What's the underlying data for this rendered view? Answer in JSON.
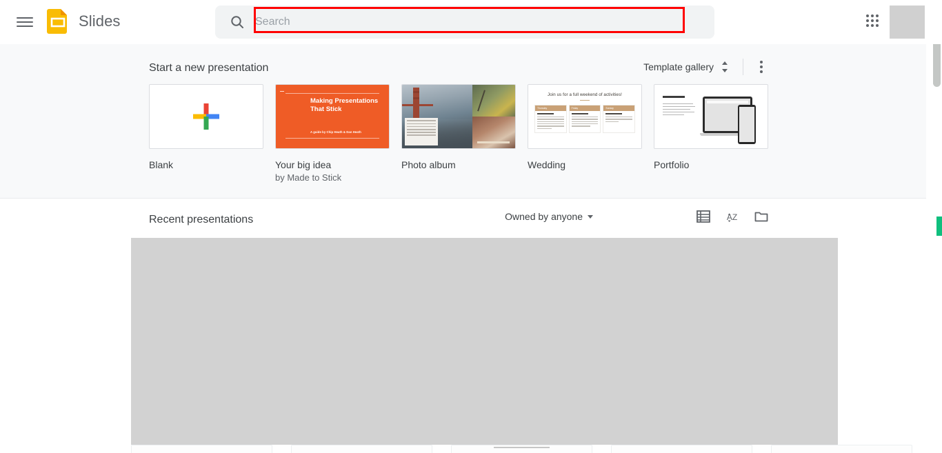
{
  "header": {
    "menu_icon": "hamburger-menu-icon",
    "logo_icon": "google-slides-logo",
    "app_title": "Slides",
    "search": {
      "icon": "search-icon",
      "placeholder": "Search",
      "value": ""
    },
    "apps_icon": "apps-grid-icon",
    "avatar": "account-avatar"
  },
  "annotation": {
    "color": "#ff0000",
    "target": "search-input"
  },
  "template_section": {
    "title": "Start a new presentation",
    "gallery_label": "Template gallery",
    "sorter_icon": "expand-collapse-icon",
    "more_icon": "more-options-icon",
    "templates": [
      {
        "name": "Blank",
        "subtitle": "",
        "thumb": "blank-plus-thumbnail"
      },
      {
        "name": "Your big idea",
        "subtitle": "by Made to Stick",
        "thumb": "your-big-idea-thumbnail",
        "slide_title": "Making Presentations That Stick",
        "slide_credit": "A guide by Chip Heath & Dan Heath",
        "accent": "#ef5c26"
      },
      {
        "name": "Photo album",
        "subtitle": "",
        "thumb": "photo-album-thumbnail",
        "caption_text": "Lorem ipsum dolor sit amet, consectetur adipiscing elit, sed do eiusmod tempor incididunt ut labore."
      },
      {
        "name": "Wedding",
        "subtitle": "",
        "thumb": "wedding-thumbnail",
        "slide_title": "Join us for a full weekend of activities!",
        "columns": [
          "Thursday",
          "Friday",
          "Sunday"
        ],
        "accent": "#c9a176"
      },
      {
        "name": "Portfolio",
        "subtitle": "",
        "thumb": "portfolio-thumbnail",
        "slide_title": "Project name"
      }
    ]
  },
  "recent_section": {
    "title": "Recent presentations",
    "owner_filter": "Owned by anyone",
    "caret_icon": "chevron-down-icon",
    "list_view_icon": "list-view-icon",
    "sort_az_icon": "sort-az-icon",
    "folder_icon": "file-picker-folder-icon",
    "content_state": "loading-placeholder"
  },
  "scrollbar": {
    "vertical": "page-scrollbar"
  },
  "colors": {
    "slides_yellow": "#f4b400",
    "text_primary": "#3c4043",
    "text_secondary": "#5f6368",
    "search_bg": "#f1f3f4",
    "strip_bg": "#f8f9fa",
    "placeholder_gray": "#d2d2d2",
    "green_marker": "#0fbf7e",
    "annotation_red": "#ff0000"
  }
}
